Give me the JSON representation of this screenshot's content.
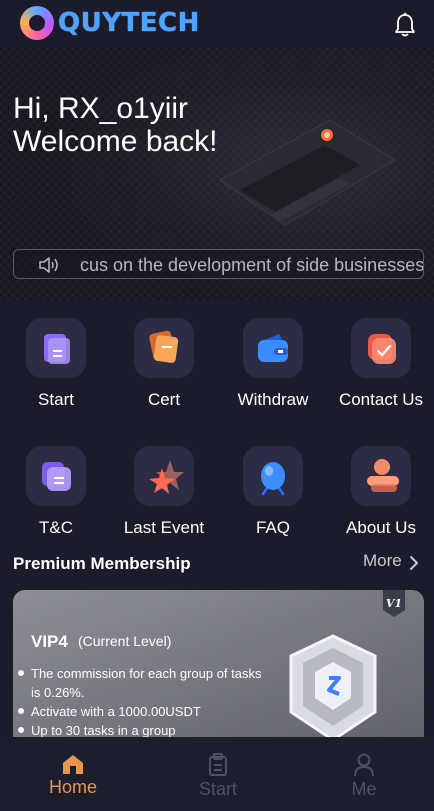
{
  "app": {
    "brand": "QUYTECH"
  },
  "greeting": {
    "line1": "Hi, RX_o1yiir",
    "line2": "Welcome back!"
  },
  "notice": {
    "text": "cus on the development of side businesses"
  },
  "menu": [
    {
      "label": "Start",
      "icon": "document-icon"
    },
    {
      "label": "Cert",
      "icon": "certificate-icon"
    },
    {
      "label": "Withdraw",
      "icon": "wallet-icon"
    },
    {
      "label": "Contact Us",
      "icon": "envelope-icon"
    },
    {
      "label": "T&C",
      "icon": "terms-icon"
    },
    {
      "label": "Last Event",
      "icon": "star-icon"
    },
    {
      "label": "FAQ",
      "icon": "question-icon"
    },
    {
      "label": "About Us",
      "icon": "people-icon"
    }
  ],
  "membership": {
    "title": "Premium Membership",
    "more": "More",
    "card": {
      "level": "VIP4",
      "current": "(Current Level)",
      "badge": "V1",
      "items": [
        "The commission for each group of tasks is 0.26%.",
        "Activate with a 1000.00USDT",
        "Up to 30 tasks in a group"
      ]
    }
  },
  "tabs": [
    {
      "label": "Home",
      "active": true
    },
    {
      "label": "Start",
      "active": false
    },
    {
      "label": "Me",
      "active": false
    }
  ],
  "colors": {
    "accent": "#e9954e",
    "inactive": "#4f5163",
    "brand": "#4ea3ff"
  }
}
